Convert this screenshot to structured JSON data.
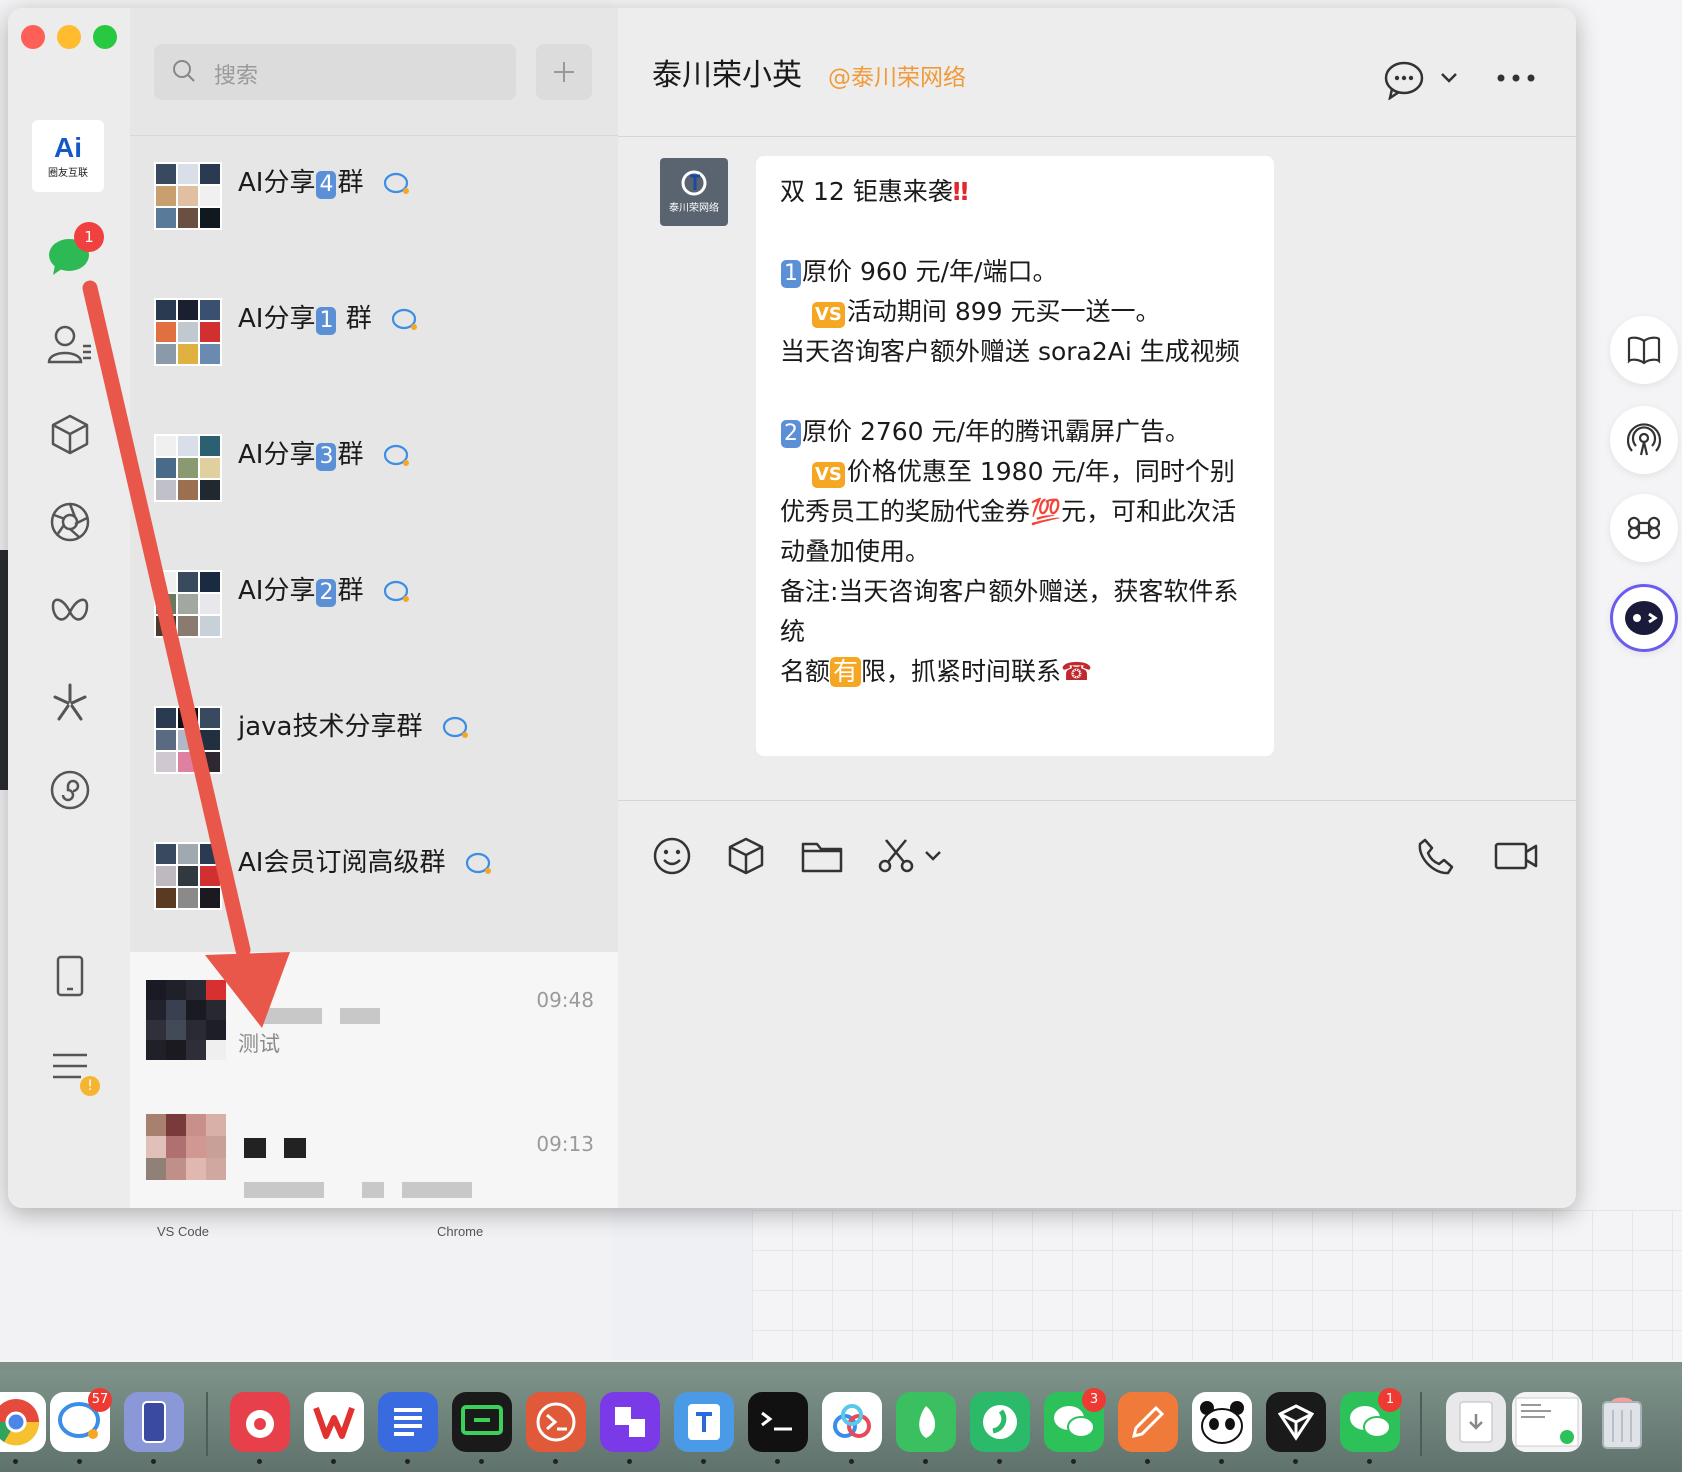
{
  "search": {
    "placeholder": "搜索"
  },
  "nav": {
    "chat_badge": "1",
    "app_logo_text": "Ai",
    "app_logo_caption": "圈友互联"
  },
  "groups": [
    {
      "name_pre": "AI分享",
      "num": "4",
      "name_post": "群"
    },
    {
      "name_pre": "AI分享",
      "num": "1",
      "name_post": " 群"
    },
    {
      "name_pre": "AI分享",
      "num": "3",
      "name_post": "群"
    },
    {
      "name_pre": "AI分享",
      "num": "2",
      "name_post": "群"
    },
    {
      "name_pre": "java技术分享群",
      "num": "",
      "name_post": ""
    },
    {
      "name_pre": "AI会员订阅高级群",
      "num": "",
      "name_post": ""
    }
  ],
  "messages": [
    {
      "time": "09:48",
      "preview": "测试"
    },
    {
      "time": "09:13",
      "preview": ""
    }
  ],
  "chat": {
    "title": "泰川荣小英",
    "org": "@泰川荣网络",
    "sender_caption": "泰川荣网络",
    "bubble": {
      "line1": "双 12 钜惠来袭",
      "k1": "1",
      "l2": "原价 960 元/年/端口。",
      "l3": "活动期间 899 元买一送一。",
      "l4": "当天咨询客户额外赠送 sora2Ai 生成视频",
      "k2": "2",
      "l5": "原价 2760 元/年的腾讯霸屏广告。",
      "l6": "价格优惠至 1980 元/年，同时个别优秀员工的奖励代金券",
      "l6b": "元，可和此次活动叠加使用。",
      "l7": "备注:当天咨询客户额外赠送，获客软件系统",
      "l8a": "名额",
      "l8b": "有",
      "l8c": "限，抓紧时间联系",
      "vs": "VS",
      "hundred": "💯",
      "phone": "☎",
      "bang": "‼"
    }
  },
  "desktop": {
    "label1": "VS Code",
    "label2": "Chrome"
  },
  "dock": {
    "badges": [
      "57",
      "3",
      "1"
    ]
  }
}
